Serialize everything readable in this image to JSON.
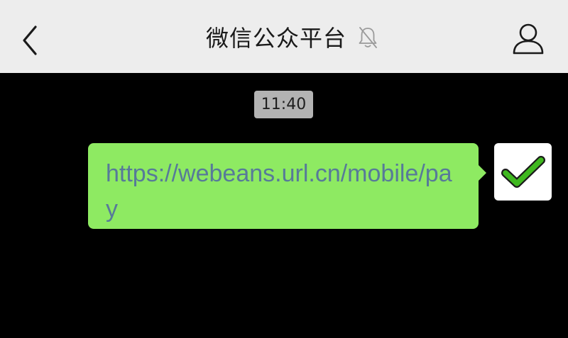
{
  "header": {
    "title": "微信公众平台",
    "back_icon": "chevron-left-icon",
    "mute_icon": "bell-muted-icon",
    "profile_icon": "person-icon",
    "background": "#ededed"
  },
  "chat": {
    "background": "#000000",
    "timestamp": "11:40",
    "messages": [
      {
        "sender": "self",
        "text": "https://webeans.url.cn/mobile/pay",
        "bubble_color": "#8eea62",
        "text_color": "#577a99",
        "avatar_icon": "green-checkmark-icon"
      }
    ]
  }
}
